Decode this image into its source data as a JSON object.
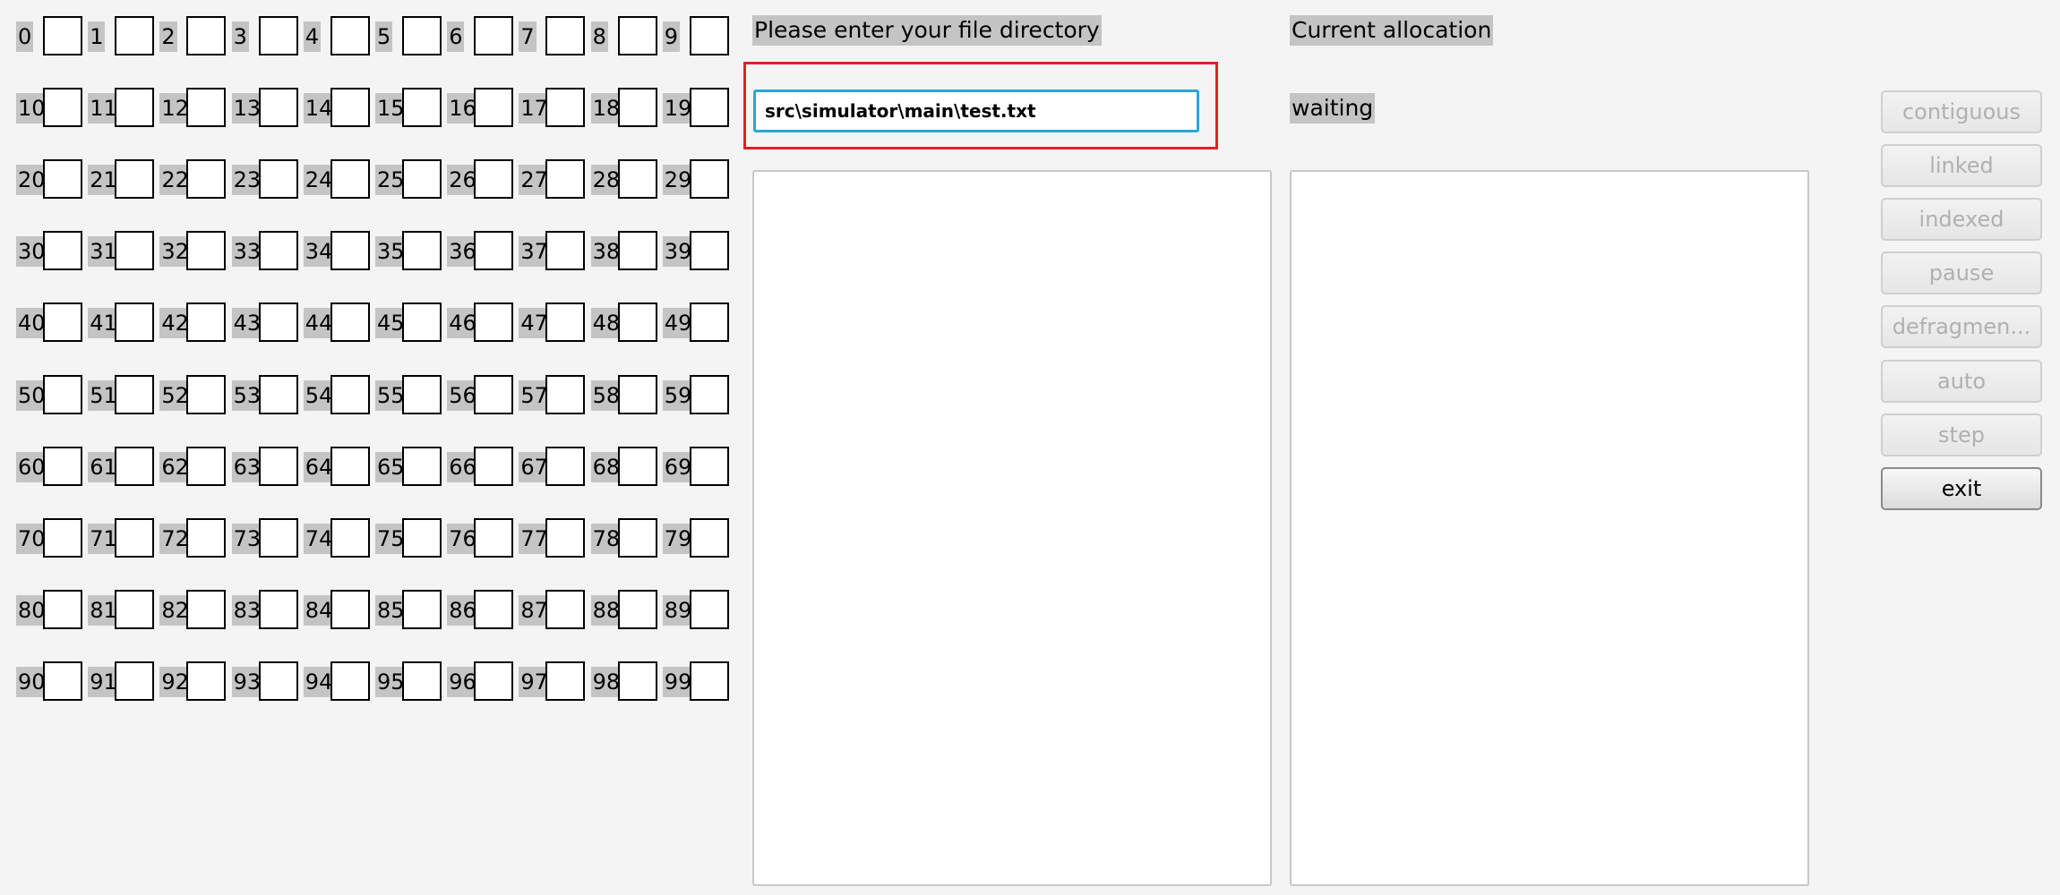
{
  "blocks": {
    "labels": [
      "0",
      "1",
      "2",
      "3",
      "4",
      "5",
      "6",
      "7",
      "8",
      "9",
      "10",
      "11",
      "12",
      "13",
      "14",
      "15",
      "16",
      "17",
      "18",
      "19",
      "20",
      "21",
      "22",
      "23",
      "24",
      "25",
      "26",
      "27",
      "28",
      "29",
      "30",
      "31",
      "32",
      "33",
      "34",
      "35",
      "36",
      "37",
      "38",
      "39",
      "40",
      "41",
      "42",
      "43",
      "44",
      "45",
      "46",
      "47",
      "48",
      "49",
      "50",
      "51",
      "52",
      "53",
      "54",
      "55",
      "56",
      "57",
      "58",
      "59",
      "60",
      "61",
      "62",
      "63",
      "64",
      "65",
      "66",
      "67",
      "68",
      "69",
      "70",
      "71",
      "72",
      "73",
      "74",
      "75",
      "76",
      "77",
      "78",
      "79",
      "80",
      "81",
      "82",
      "83",
      "84",
      "85",
      "86",
      "87",
      "88",
      "89",
      "90",
      "91",
      "92",
      "93",
      "94",
      "95",
      "96",
      "97",
      "98",
      "99"
    ]
  },
  "directory": {
    "prompt": "Please enter your file directory",
    "value": "src\\simulator\\main\\test.txt"
  },
  "allocation": {
    "title": "Current allocation",
    "status": "waiting"
  },
  "panels": {
    "left_text": "",
    "right_text": ""
  },
  "buttons": [
    {
      "label": "contiguous",
      "enabled": false
    },
    {
      "label": "linked",
      "enabled": false
    },
    {
      "label": "indexed",
      "enabled": false
    },
    {
      "label": "pause",
      "enabled": false
    },
    {
      "label": "defragmen...",
      "enabled": false
    },
    {
      "label": "auto",
      "enabled": false
    },
    {
      "label": "step",
      "enabled": false
    },
    {
      "label": "exit",
      "enabled": true
    }
  ],
  "colors": {
    "label_highlight": "#c4c4c4",
    "input_focus": "#2aa5dd",
    "annotation_box": "#e0202a",
    "background": "#f4f4f4"
  }
}
